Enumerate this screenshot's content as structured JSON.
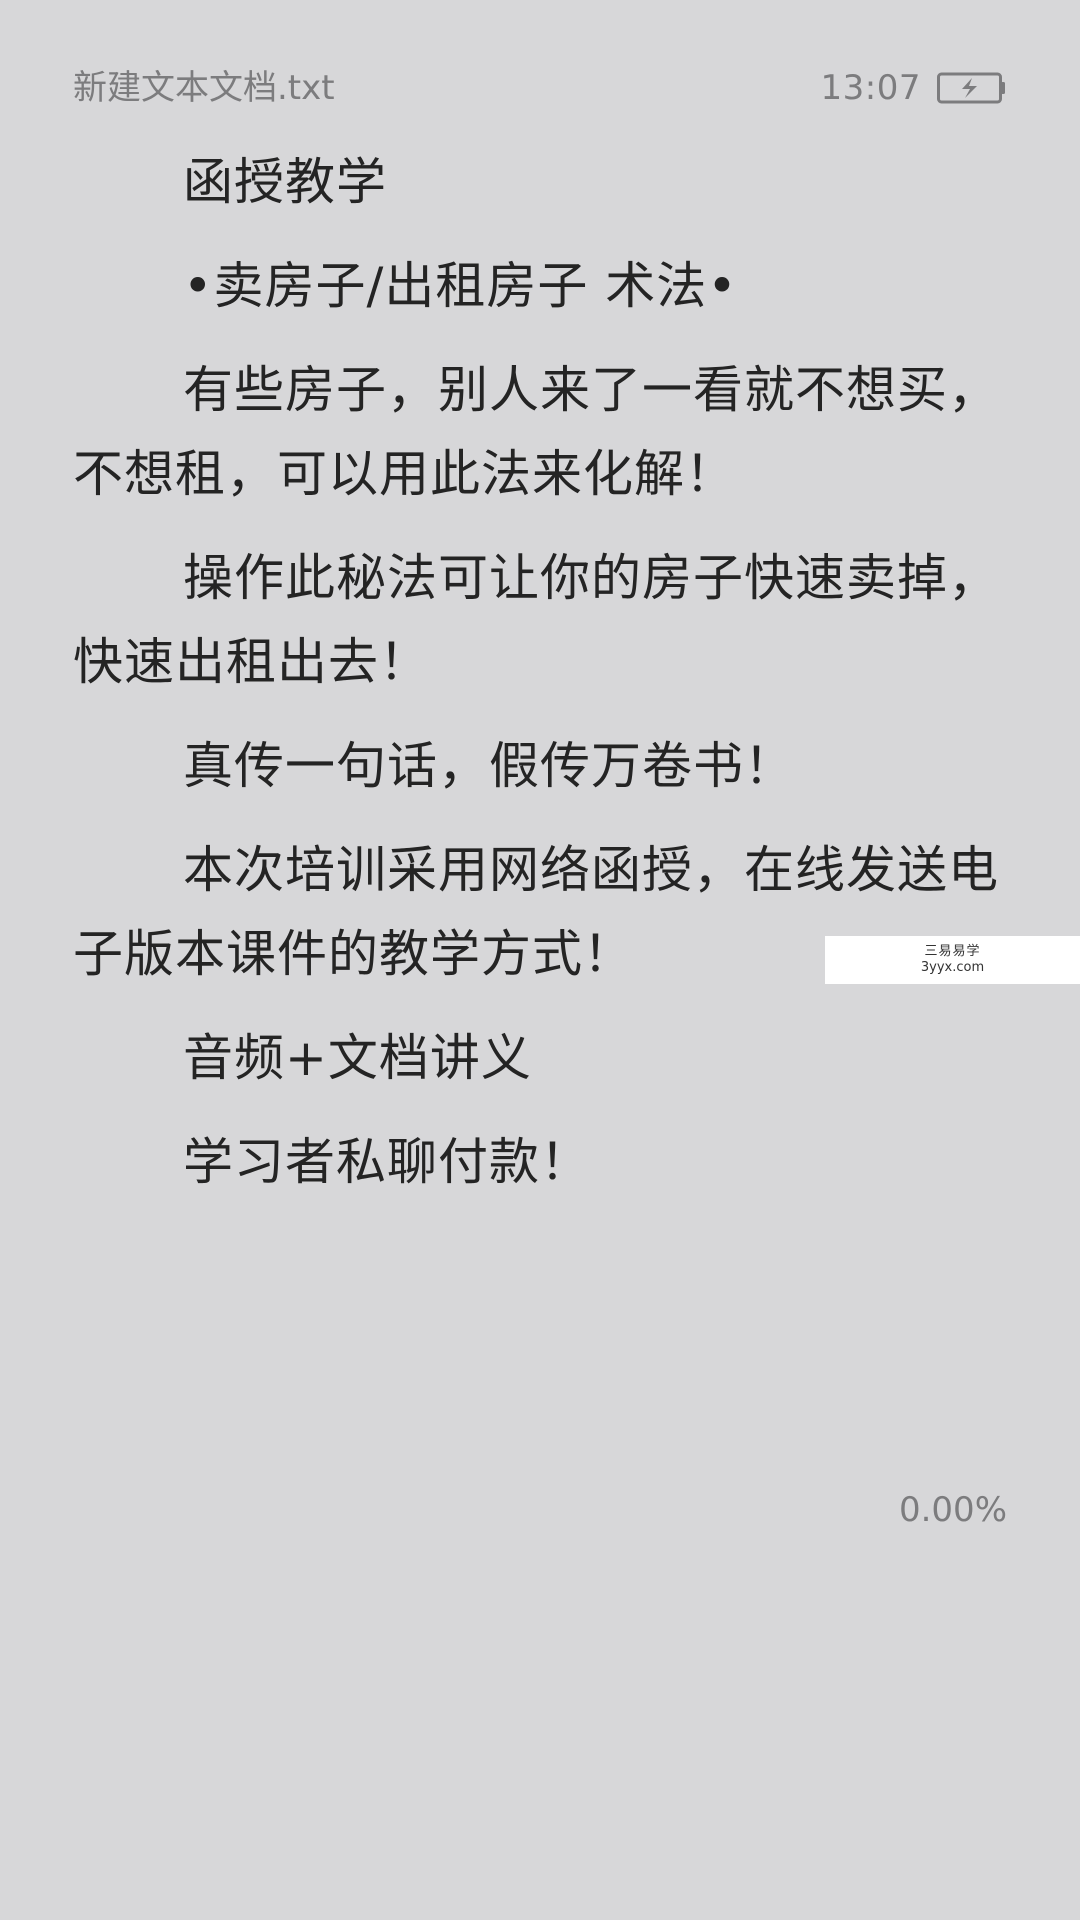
{
  "status_bar": {
    "file_name": "新建文本文档.txt",
    "time": "13:07",
    "battery_icon": "battery-charging-icon"
  },
  "content": {
    "paragraphs": [
      "函授教学",
      "•卖房子/出租房子 术法•",
      "有些房子，别人来了一看就不想买，不想租，可以用此法来化解！",
      "操作此秘法可让你的房子快速卖掉，快速出租出去！",
      "真传一句话，假传万卷书！",
      "本次培训采用网络函授，在线发送电子版本课件的教学方式！",
      "音频+文档讲义",
      "学习者私聊付款！"
    ]
  },
  "watermark": {
    "line1": "三易易学",
    "line2": "3yyx.com"
  },
  "footer": {
    "progress": "0.00%"
  },
  "colors": {
    "background": "#d7d7d9",
    "text": "#242424",
    "status_text": "#7c7c7e"
  }
}
